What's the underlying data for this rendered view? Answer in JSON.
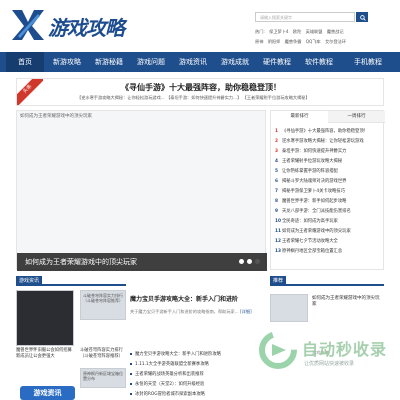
{
  "site": {
    "logo_text": "游戏攻略",
    "logo_icon": "yx-logo-icon"
  },
  "search": {
    "placeholder": "请输入搜索关键字"
  },
  "hot": {
    "label": "热门:",
    "row1": [
      "保卫萝卜4",
      "欧陀",
      "英雄联盟",
      "魔兽战记"
    ],
    "row2": [
      "原神",
      "阴阳师",
      "魔兽争霸",
      "QQ飞车",
      "艾尔登法环"
    ]
  },
  "nav": {
    "items": [
      "首页",
      "新游攻略",
      "新游秘籍",
      "游戏问题",
      "游戏资讯",
      "游戏成就",
      "硬件教程",
      "软件教程",
      "手机教程"
    ],
    "active_index": 0
  },
  "banner": {
    "corner_label": "头条",
    "title": "《寻仙手游》十大最强阵容，助你稳稳登顶！",
    "links": [
      "【逆水寒手游攻略大揭秘：让你轻松游玩游戏...",
      "【泰坦手游：如何快速提升神爵实力...】",
      "【王者荣耀射手位游玩攻略大揭秘】"
    ]
  },
  "slider": {
    "image_alt": "如何成为王者荣耀游戏中的顶尖玩家",
    "caption": "如何成为王者荣耀游戏中的顶尖玩家",
    "dots": 3,
    "active_dot": 2
  },
  "rank": {
    "tabs": [
      "最新排行",
      "一周排行"
    ],
    "active_tab": 0,
    "items": [
      "《寻仙手游》十大最强阵容，助你稳稳登顶！",
      "逆水寒手游攻略大揭秘：让你轻松游玩游戏",
      "泰坦手游：如何快速提升神爵实力",
      "王者荣耀射手位游玩攻略大揭秘",
      "让你熟练掌握手游的阵容搭配",
      "揭秘斗罗大陆魂师对决的游戏世界",
      "揭秘手游保卫萝卜4关卡攻略技巧",
      "魔兽世界手游：新手如何起步攻略",
      "天龙八部手游：全门派技能伤害排名",
      "全民奇迹：如何成为高手玩家",
      "如何成为王者荣耀游戏中的顶尖玩家",
      "王者荣耀七夕节活动攻略大全",
      "原神枫丹地区全部宝箱位置汇总"
    ]
  },
  "news": {
    "section_title": "游戏资讯",
    "thumb1_label": "",
    "thumb1_caption": "魔兽世界怀旧服公会如何招募新成员让公会更强大",
    "thumb2_label": "斗破苍穹阵容实力排行（斗破苍穹阵容推荐）",
    "thumb2_caption": "斗破苍穹阵容实力排行（斗破苍穹阵容推荐）",
    "thumb3_label": "原神枫丹新区域宝箱位置分布",
    "game_badge": "游戏资讯"
  },
  "feature": {
    "title": "魔力宝贝手游攻略大全：新手入门和进阶",
    "desc": "关于魔力宝贝手游新手入门和进阶的攻略指南，帮助玩家...",
    "more": "[详细]",
    "list": [
      "魔力宝贝手游攻略大全：新手入门和进阶攻略",
      "1.11.1大全手游英雄联盟全新赛季攻略",
      "王者荣耀的战场英雄分析和出装推荐",
      "永恒的天堂（天堂2）：如何升级经验",
      "冰封的ROG冒险者城市探索副本攻略"
    ]
  },
  "side": {
    "section_title": "推荐",
    "entry_title": "如何成为王者荣耀游戏中的顶尖玩家",
    "entry_meta": "游戏攻略"
  },
  "watermark": {
    "text": "自动秒收录",
    "sub": "让优质网站快速被收录"
  }
}
